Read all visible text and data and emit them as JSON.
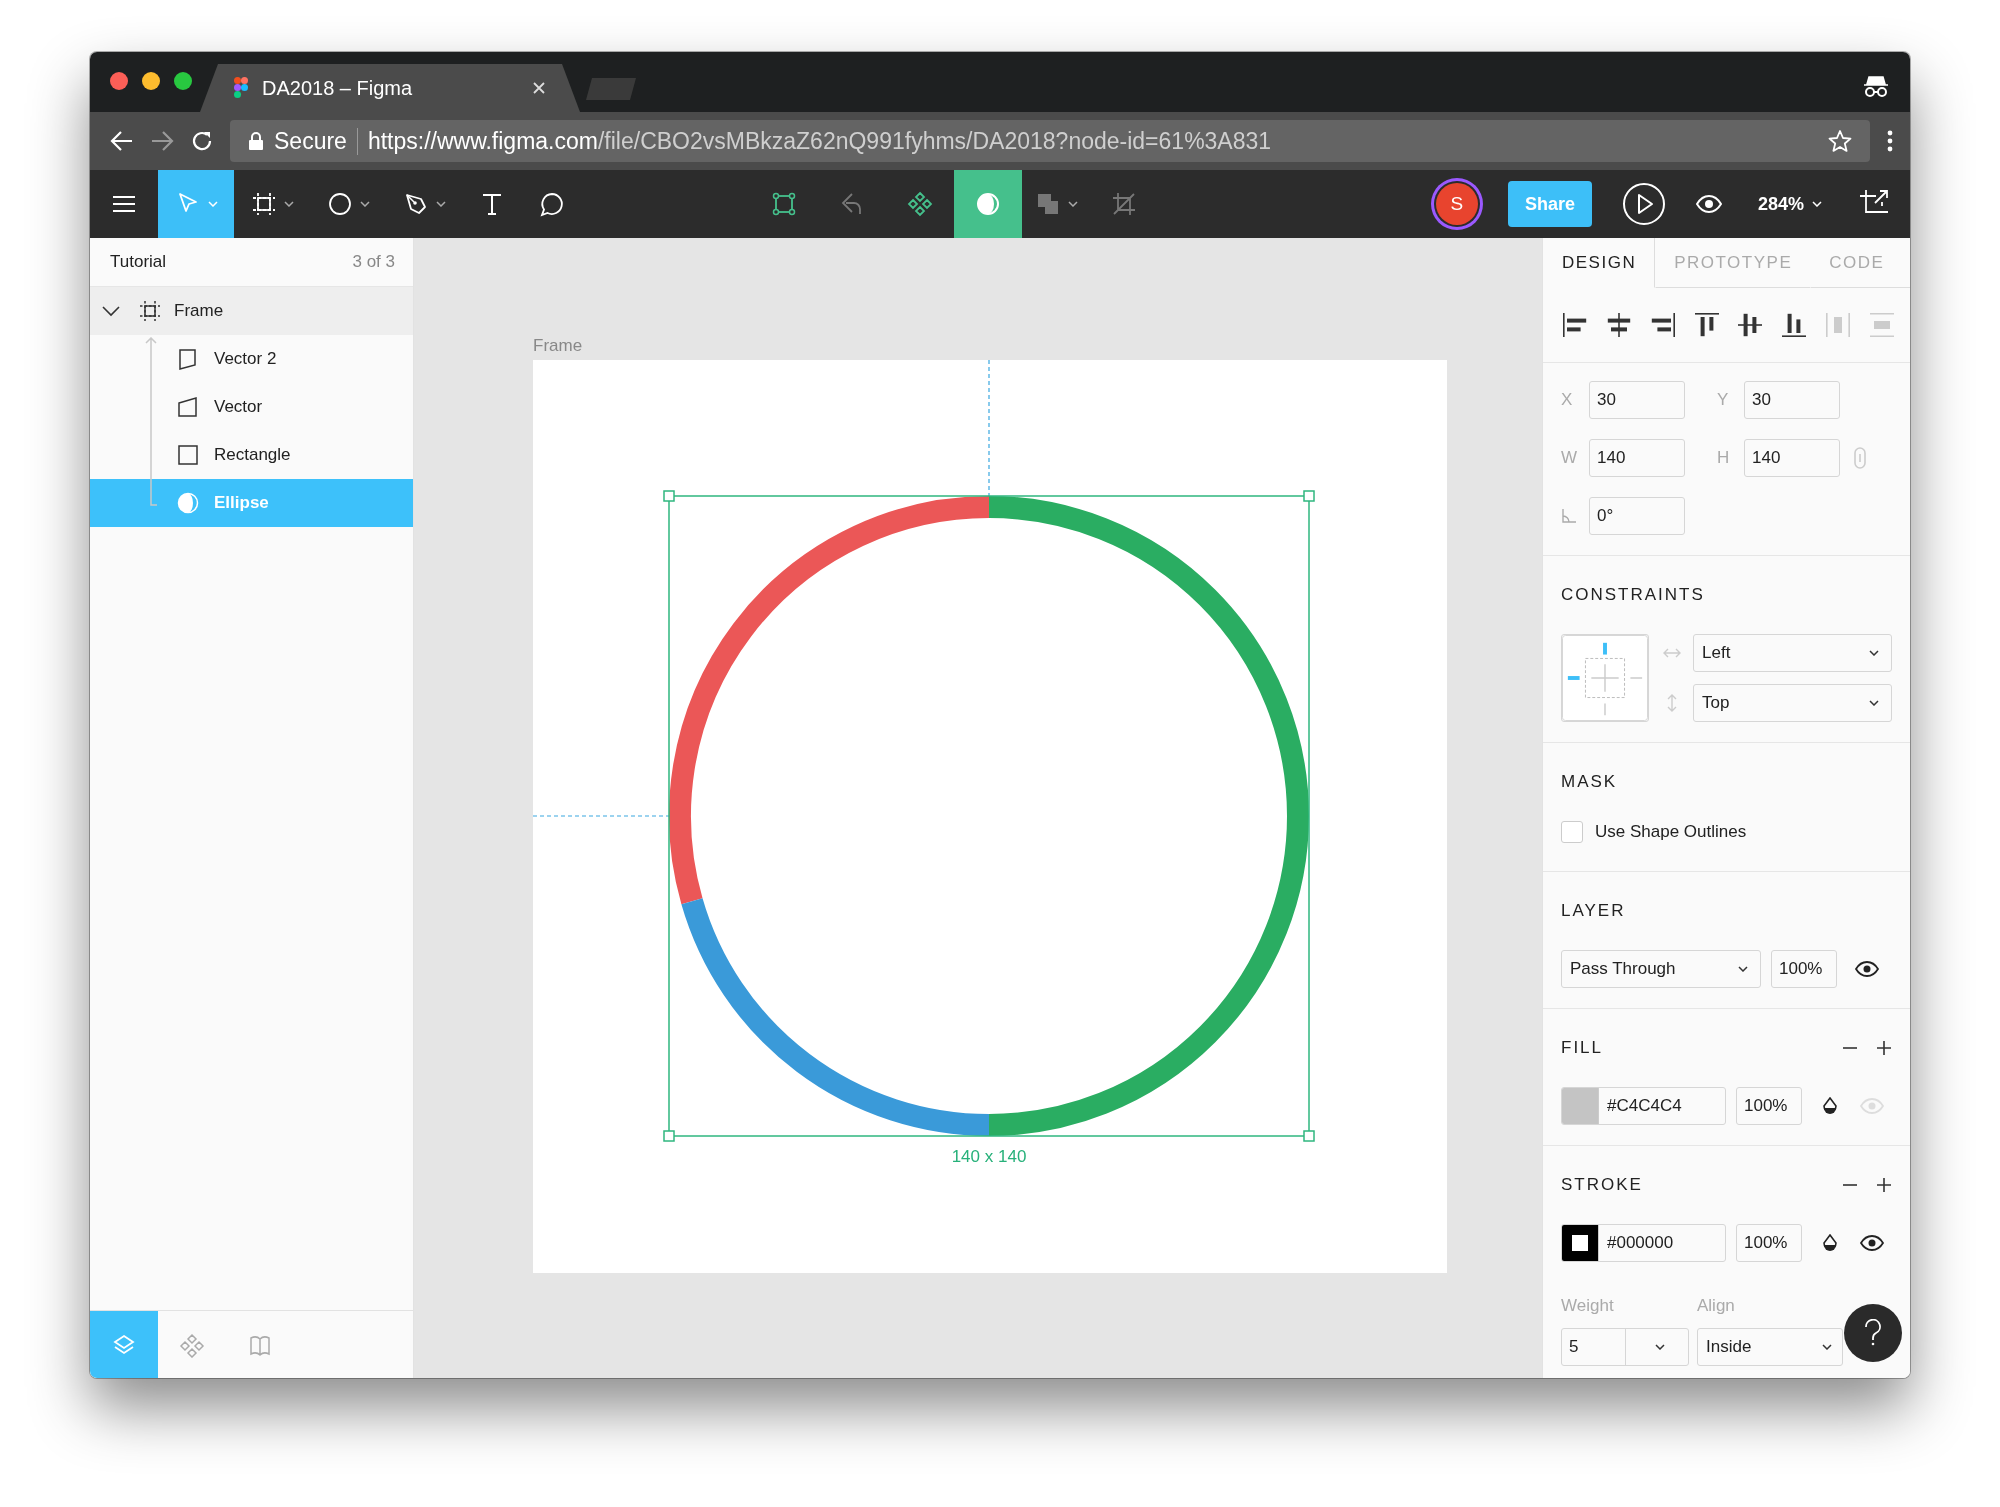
{
  "browser": {
    "tab": {
      "title": "DA2018 – Figma"
    },
    "address": {
      "secure_label": "Secure",
      "host": "https://www.figma.com",
      "path": "/file/CBO2vsMBkzaZ62nQ991fyhms/DA2018?node-id=61%3A831"
    }
  },
  "toolbar": {
    "tools": [
      {
        "kind": "move",
        "selected": true,
        "menu": true
      },
      {
        "kind": "frame",
        "selected": false,
        "menu": true
      },
      {
        "kind": "ellipse",
        "selected": false,
        "menu": true
      },
      {
        "kind": "pen",
        "selected": false,
        "menu": true
      },
      {
        "kind": "text",
        "selected": false,
        "menu": false
      },
      {
        "kind": "comment",
        "selected": false,
        "menu": false
      }
    ],
    "center_tools": [
      {
        "kind": "edit",
        "selected": false,
        "disabled": false,
        "menu": false
      },
      {
        "kind": "swap",
        "selected": false,
        "disabled": true,
        "menu": false
      },
      {
        "kind": "component",
        "selected": false,
        "disabled": false,
        "menu": false
      },
      {
        "kind": "mask",
        "selected": true,
        "disabled": false,
        "menu": false
      },
      {
        "kind": "boolean",
        "selected": false,
        "disabled": true,
        "menu": true
      },
      {
        "kind": "crop",
        "selected": false,
        "disabled": true,
        "menu": false
      }
    ],
    "avatar": {
      "initial": "S"
    },
    "share": "Share",
    "zoom": "284%"
  },
  "layers_panel": {
    "page": "Tutorial",
    "page_count": "3 of 3",
    "layers": [
      {
        "name": "Frame",
        "kind": "frame",
        "expanded": true,
        "selected": false,
        "highlighted": true,
        "children": [
          {
            "name": "Vector 2",
            "kind": "vector2",
            "selected": false
          },
          {
            "name": "Vector",
            "kind": "vector",
            "selected": false
          },
          {
            "name": "Rectangle",
            "kind": "rectangle",
            "selected": false
          },
          {
            "name": "Ellipse",
            "kind": "ellipse",
            "selected": true
          }
        ]
      }
    ],
    "bottom_tabs": [
      {
        "kind": "layers",
        "selected": true
      },
      {
        "kind": "components",
        "selected": false
      },
      {
        "kind": "library",
        "selected": false
      }
    ]
  },
  "canvas": {
    "frame_label": "Frame",
    "size_label": "140 x 140"
  },
  "inspector": {
    "tabs": [
      {
        "label": "DESIGN",
        "selected": true
      },
      {
        "label": "PROTOTYPE",
        "selected": false
      },
      {
        "label": "CODE",
        "selected": false
      }
    ],
    "align": [
      {
        "kind": "left",
        "disabled": false
      },
      {
        "kind": "hcenter",
        "disabled": false
      },
      {
        "kind": "right",
        "disabled": false
      },
      {
        "kind": "top",
        "disabled": false
      },
      {
        "kind": "vcenter",
        "disabled": false
      },
      {
        "kind": "bottom",
        "disabled": false
      },
      {
        "kind": "dist-h",
        "disabled": true
      },
      {
        "kind": "dist-v",
        "disabled": true
      }
    ],
    "x": {
      "label": "X",
      "value": "30"
    },
    "y": {
      "label": "Y",
      "value": "30"
    },
    "w": {
      "label": "W",
      "value": "140"
    },
    "h": {
      "label": "H",
      "value": "140"
    },
    "rotation": {
      "value": "0°"
    },
    "constraints": {
      "title": "CONSTRAINTS",
      "horizontal": "Left",
      "vertical": "Top"
    },
    "mask": {
      "title": "MASK",
      "option": "Use Shape Outlines",
      "checked": false
    },
    "layer": {
      "title": "LAYER",
      "blend": "Pass Through",
      "opacity": "100%",
      "visible": true
    },
    "fill": {
      "title": "FILL",
      "color": "#c4c4c4",
      "hex": "#C4C4C4",
      "opacity": "100%",
      "visible": false
    },
    "stroke": {
      "title": "STROKE",
      "color": "#000000",
      "hex": "#000000",
      "opacity": "100%",
      "visible": true,
      "weight_label": "Weight",
      "weight": "5",
      "align_label": "Align",
      "align": "Inside"
    }
  }
}
